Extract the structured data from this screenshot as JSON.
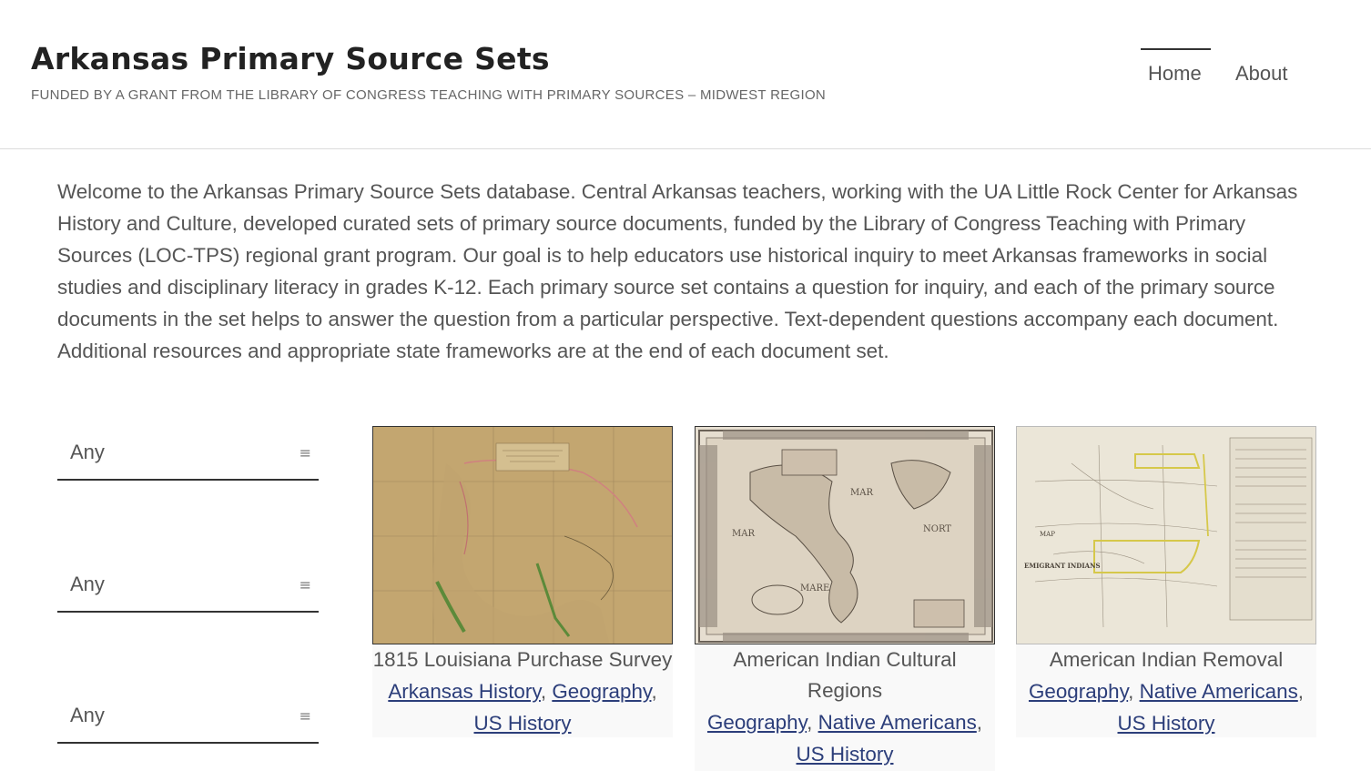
{
  "site": {
    "title": "Arkansas Primary Source Sets",
    "tagline": "FUNDED BY A GRANT FROM THE LIBRARY OF CONGRESS TEACHING WITH PRIMARY SOURCES – MIDWEST REGION"
  },
  "nav": {
    "items": [
      {
        "label": "Home",
        "active": true
      },
      {
        "label": "About",
        "active": false
      }
    ]
  },
  "intro": {
    "text": "Welcome to the Arkansas Primary Source Sets database. Central Arkansas teachers, working with the UA Little Rock Center for Arkansas History and Culture, developed curated sets of primary source documents, funded by the Library of Congress Teaching with Primary Sources (LOC-TPS) regional grant program. Our goal is to help educators use historical inquiry to meet Arkansas frameworks in social studies and disciplinary literacy in grades K-12. Each primary source set contains a question for inquiry, and each of the primary source documents in the set helps to answer the question from a particular perspective. Text-dependent questions accompany each document. Additional resources and appropriate state frameworks are at the end of each document set."
  },
  "filters": [
    {
      "value": "Any",
      "icon": "menu-lines-icon"
    },
    {
      "value": "Any",
      "icon": "menu-lines-icon"
    },
    {
      "value": "Any",
      "icon": "menu-lines-icon"
    }
  ],
  "filter_icon_glyph": "≡",
  "tag_separator": ", ",
  "tag_end": ",",
  "cards": [
    {
      "title": "1815 Louisiana Purchase Survey",
      "tags": [
        "Arkansas History",
        "Geography",
        "US History"
      ],
      "image": "map-north-america-1815"
    },
    {
      "title": "American Indian Cultural Regions",
      "tags": [
        "Geography",
        "Native Americans",
        "US History"
      ],
      "image": "map-americas-antique"
    },
    {
      "title": "American Indian Removal",
      "tags": [
        "Geography",
        "Native Americans",
        "US History"
      ],
      "image": "map-emigrant-indians"
    }
  ],
  "colors": {
    "link": "#2c3e7a",
    "text": "#555555",
    "title": "#222222"
  }
}
